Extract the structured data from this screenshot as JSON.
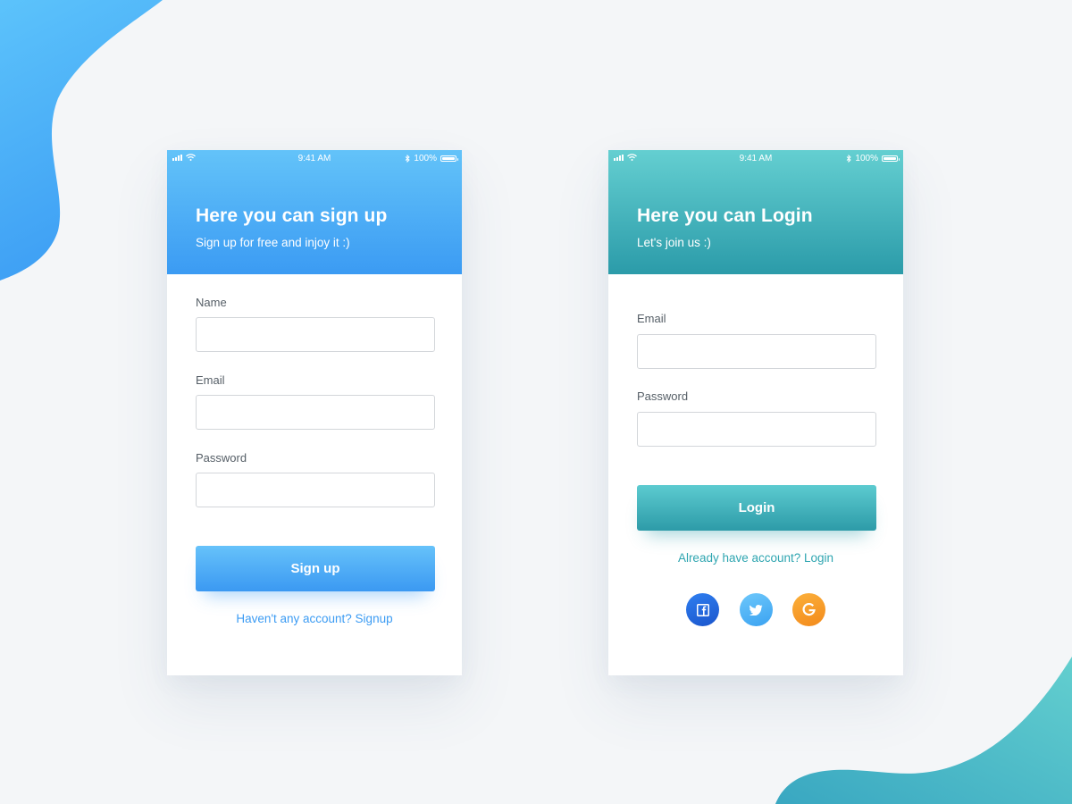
{
  "signup": {
    "status": {
      "time": "9:41 AM",
      "battery": "100%"
    },
    "title": "Here you can sign up",
    "subtitle": "Sign up for free and injoy it :)",
    "fields": {
      "name_label": "Name",
      "email_label": "Email",
      "password_label": "Password"
    },
    "button_label": "Sign up",
    "alt_link": "Haven't any account? Signup"
  },
  "login": {
    "status": {
      "time": "9:41 AM",
      "battery": "100%"
    },
    "title": "Here you can Login",
    "subtitle": "Let's join us :)",
    "fields": {
      "email_label": "Email",
      "password_label": "Password"
    },
    "button_label": "Login",
    "alt_link": "Already have account? Login",
    "social": [
      "facebook-icon",
      "twitter-icon",
      "google-icon"
    ]
  },
  "colors": {
    "signup_accent": "#3b9bf3",
    "login_accent": "#2d9ba8",
    "facebook": "#1a55cc",
    "twitter": "#3aa2f1",
    "google": "#f38a1b",
    "background": "#f4f6f8"
  }
}
